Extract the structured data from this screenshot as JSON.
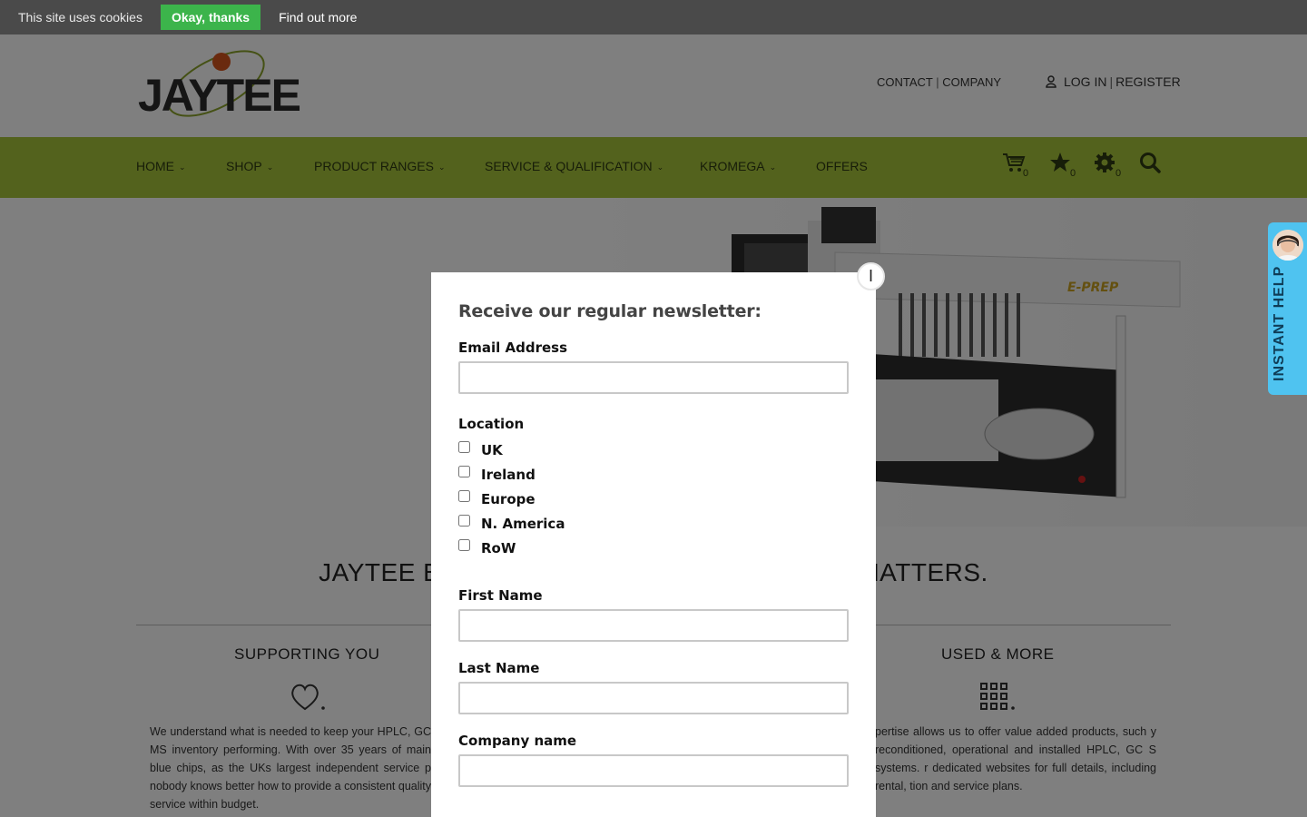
{
  "cookie_bar": {
    "message": "This site uses cookies",
    "accept_label": "Okay, thanks",
    "more_label": "Find out more"
  },
  "header": {
    "logo_text": "JAYTEE",
    "top_links": [
      "CONTACT",
      "COMPANY"
    ],
    "account_links": [
      "LOG IN",
      "REGISTER"
    ],
    "separator": "|"
  },
  "nav": {
    "items": [
      {
        "label": "HOME",
        "has_dropdown": true
      },
      {
        "label": "SHOP",
        "has_dropdown": true
      },
      {
        "label": "PRODUCT RANGES",
        "has_dropdown": true
      },
      {
        "label": "SERVICE & QUALIFICATION",
        "has_dropdown": true
      },
      {
        "label": "KROMEGA",
        "has_dropdown": true
      },
      {
        "label": "OFFERS",
        "has_dropdown": false
      }
    ],
    "chevron": "⌄",
    "icons": [
      {
        "name": "cart-icon",
        "count": "0"
      },
      {
        "name": "star-icon",
        "count": "0"
      },
      {
        "name": "gear-icon",
        "count": "0"
      },
      {
        "name": "search-icon"
      }
    ],
    "bar_color": "#a7c43a"
  },
  "hero": {
    "product_badge": "E-PREP"
  },
  "page": {
    "tagline_left": "JAYTEE B",
    "tagline_right": "MATTERS.",
    "sections": [
      {
        "title": "SUPPORTING YOU",
        "icon": "heart-icon",
        "text": "We understand what is needed to keep your HPLC, GC MS inventory performing. With over 35 years of main blue chips, as the UKs largest independent service p nobody knows better how to provide a consistent quality service within budget."
      },
      {
        "title": "USED & MORE",
        "icon": "grid-icon",
        "text": "pertise allows us to offer value added products, such y reconditioned, operational and installed HPLC, GC S systems. r dedicated websites for full details, including rental, tion and service plans."
      }
    ]
  },
  "instant_help": {
    "label": "INSTANT HELP",
    "color": "#4fc3f0"
  },
  "modal": {
    "close_label": "I",
    "title": "Receive our regular newsletter:",
    "email_label": "Email Address",
    "location_label": "Location",
    "locations": [
      "UK",
      "Ireland",
      "Europe",
      "N. America",
      "RoW"
    ],
    "first_name_label": "First Name",
    "last_name_label": "Last Name",
    "company_label": "Company name"
  }
}
